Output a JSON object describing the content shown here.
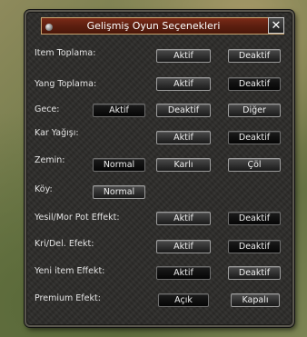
{
  "window": {
    "title": "Gelişmiş Oyun Seçenekleri",
    "close_glyph": "✕"
  },
  "rows": [
    {
      "label": "Item Toplama:",
      "buttons": [
        "Aktif",
        "Deaktif"
      ]
    },
    {
      "label": "Yang Toplama:",
      "buttons": [
        "Aktif",
        "Deaktif"
      ]
    },
    {
      "label": "Gece:",
      "buttons": [
        "Aktif",
        "Deaktif",
        "Diğer"
      ]
    },
    {
      "label": "Kar Yağışı:",
      "buttons": [
        "Aktif",
        "Deaktif"
      ]
    },
    {
      "label": "Zemin:",
      "buttons": [
        "Normal",
        "Karlı",
        "Çöl"
      ]
    },
    {
      "label": "Köy:",
      "buttons": [
        "Normal"
      ]
    },
    {
      "label": "Yesil/Mor Pot Effekt:",
      "buttons": [
        "Aktif",
        "Deaktif"
      ]
    },
    {
      "label": "Kri/Del. Efekt:",
      "buttons": [
        "Aktif",
        "Deaktif"
      ]
    },
    {
      "label": "Yeni item Effekt:",
      "buttons": [
        "Aktif",
        "Deaktif"
      ]
    },
    {
      "label": "Premium Efekt:",
      "buttons": [
        "Açık",
        "Kapalı"
      ]
    }
  ],
  "colors": {
    "title_bar": "#5c1f10",
    "title_border": "#caa571",
    "panel": "#2d2c2a",
    "text": "#e4e4e4"
  }
}
